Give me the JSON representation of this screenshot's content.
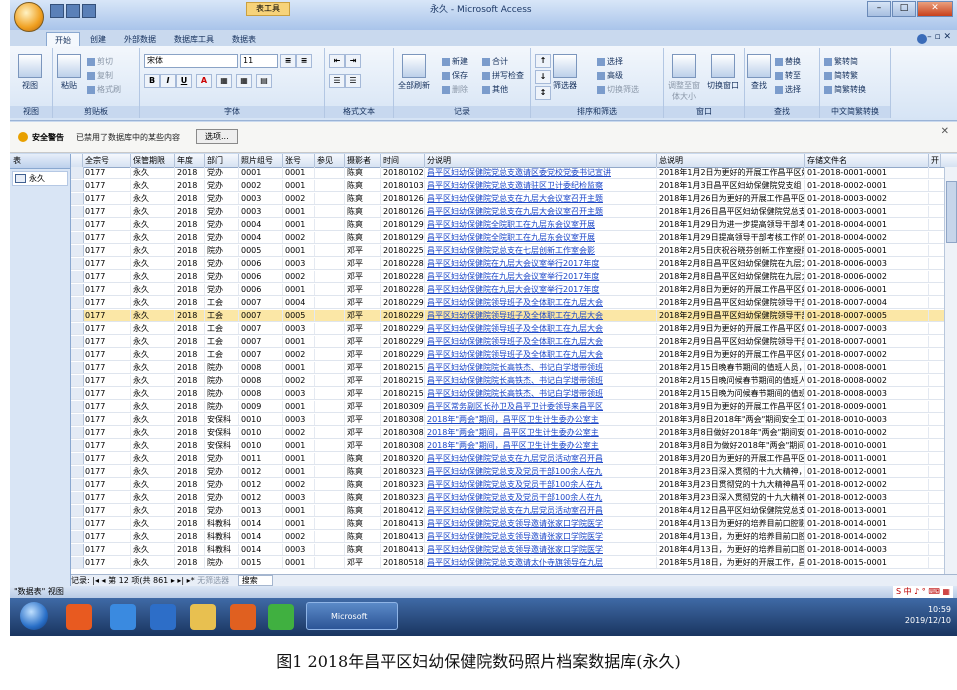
{
  "window": {
    "title": "永久 - Microsoft Access",
    "context_tab": "表工具"
  },
  "ribbon": {
    "tabs": [
      "开始",
      "创建",
      "外部数据",
      "数据库工具",
      "数据表"
    ],
    "clipboard": {
      "paste": "粘贴",
      "cut": "剪切",
      "copy": "复制",
      "format_painter": "格式刷",
      "label": "剪贴板"
    },
    "views": {
      "view": "视图",
      "label": "视图"
    },
    "font": {
      "name": "宋体",
      "size": "11",
      "label": "字体"
    },
    "richtext": {
      "label": "格式文本"
    },
    "records": {
      "refresh": "全部刷新",
      "new": "新建",
      "save": "保存",
      "delete": "删除",
      "totals": "合计",
      "spelling": "拼写检查",
      "more": "其他",
      "label": "记录"
    },
    "sortfilter": {
      "filter": "筛选器",
      "selection": "选择",
      "advanced": "高级",
      "toggle": "切换筛选",
      "label": "排序和筛选"
    },
    "window": {
      "fit": "调整至窗体大小",
      "switch": "切换窗口",
      "label": "窗口"
    },
    "find": {
      "find": "查找",
      "replace": "替换",
      "goto": "转至",
      "select": "选择",
      "label": "查找"
    },
    "chinese": {
      "t2s": "繁转简",
      "s2t": "简转繁",
      "convert": "简繁转换",
      "label": "中文简繁转换"
    }
  },
  "security": {
    "title": "安全警告",
    "message": "已禁用了数据库中的某些内容",
    "button": "选项..."
  },
  "nav": {
    "header": "表",
    "item": "永久"
  },
  "columns": [
    "全宗号",
    "保管期限",
    "年度",
    "部门",
    "照片组号",
    "张号",
    "参见",
    "摄影者",
    "时间",
    "分说明",
    "总说明",
    "存储文件名",
    "开"
  ],
  "rows": [
    [
      "0177",
      "永久",
      "2018",
      "党办",
      "0001",
      "0001",
      "",
      "陈爽",
      "20180102",
      "昌平区妇幼保健院党总支邀请区委党校党委书记宣讲",
      "2018年1月2日为更好的开展工作昌平区妇",
      "01-2018-0001-0001"
    ],
    [
      "0177",
      "永久",
      "2018",
      "党办",
      "0002",
      "0001",
      "",
      "陈爽",
      "20180103",
      "昌平区妇幼保健院党总支邀请驻区卫计委纪检监察",
      "2018年1月3日昌平区妇幼保健院党支组",
      "01-2018-0002-0001"
    ],
    [
      "0177",
      "永久",
      "2018",
      "党办",
      "0003",
      "0002",
      "",
      "陈爽",
      "20180126",
      "昌平区妇幼保健院党总支在九层大会议室召开主题",
      "2018年1月26日为更好的开展工作昌平区妇",
      "01-2018-0003-0002"
    ],
    [
      "0177",
      "永久",
      "2018",
      "党办",
      "0003",
      "0001",
      "",
      "陈爽",
      "20180126",
      "昌平区妇幼保健院党总支在九层大会议室召开主题",
      "2018年1月26日昌平区妇幼保健院党总支",
      "01-2018-0003-0001"
    ],
    [
      "0177",
      "永久",
      "2018",
      "党办",
      "0004",
      "0001",
      "",
      "陈爽",
      "20180129",
      "昌平区妇幼保健院全院职工在九层东会议室开展",
      "2018年1月29日为进一步提高领导干部考核",
      "01-2018-0004-0001"
    ],
    [
      "0177",
      "永久",
      "2018",
      "党办",
      "0004",
      "0002",
      "",
      "陈爽",
      "20180129",
      "昌平区妇幼保健院全院职工在九层东会议室开展",
      "2018年1月29日提高领导干部考核工作的科",
      "01-2018-0004-0002"
    ],
    [
      "0177",
      "永久",
      "2018",
      "院办",
      "0005",
      "0001",
      "",
      "邓平",
      "20180225",
      "昌平区妇幼保健院党总支在七层创新工作室会影",
      "2018年2月5日庆祝谷晓芬创新工作室授牌",
      "01-2018-0005-0001"
    ],
    [
      "0177",
      "永久",
      "2018",
      "党办",
      "0006",
      "0003",
      "",
      "邓平",
      "20180228",
      "昌平区妇幼保健院在九层大会议室举行2017年度",
      "2018年2月8日昌平区妇幼保健院在九层大",
      "01-2018-0006-0003"
    ],
    [
      "0177",
      "永久",
      "2018",
      "党办",
      "0006",
      "0002",
      "",
      "邓平",
      "20180228",
      "昌平区妇幼保健院在九层大会议室举行2017年度",
      "2018年2月8日昌平区妇幼保健院在九层大",
      "01-2018-0006-0002"
    ],
    [
      "0177",
      "永久",
      "2018",
      "党办",
      "0006",
      "0001",
      "",
      "邓平",
      "20180228",
      "昌平区妇幼保健院在九层大会议室举行2017年度",
      "2018年2月8日为更好的开展工作昌平区妇",
      "01-2018-0006-0001"
    ],
    [
      "0177",
      "永久",
      "2018",
      "工会",
      "0007",
      "0004",
      "",
      "邓平",
      "20180229",
      "昌平区妇幼保健院领导班子及全体职工在九层大会",
      "2018年2月9日昌平区妇幼保健院领导干部",
      "01-2018-0007-0004"
    ],
    [
      "0177",
      "永久",
      "2018",
      "工会",
      "0007",
      "0005",
      "",
      "邓平",
      "20180229",
      "昌平区妇幼保健院领导班子及全体职工在九层大会",
      "2018年2月9日昌平区妇幼保健院领导干部",
      "01-2018-0007-0005"
    ],
    [
      "0177",
      "永久",
      "2018",
      "工会",
      "0007",
      "0003",
      "",
      "邓平",
      "20180229",
      "昌平区妇幼保健院领导班子及全体职工在九层大会",
      "2018年2月9日为更好的开展工作昌平区妇",
      "01-2018-0007-0003"
    ],
    [
      "0177",
      "永久",
      "2018",
      "工会",
      "0007",
      "0001",
      "",
      "邓平",
      "20180229",
      "昌平区妇幼保健院领导班子及全体职工在九层大会",
      "2018年2月9日昌平区妇幼保健院领导干部",
      "01-2018-0007-0001"
    ],
    [
      "0177",
      "永久",
      "2018",
      "工会",
      "0007",
      "0002",
      "",
      "邓平",
      "20180229",
      "昌平区妇幼保健院领导班子及全体职工在九层大会",
      "2018年2月9日为更好的开展工作昌平区妇",
      "01-2018-0007-0002"
    ],
    [
      "0177",
      "永久",
      "2018",
      "院办",
      "0008",
      "0001",
      "",
      "邓平",
      "20180215",
      "昌平区妇幼保健院院长高铁杰、书记白学增带领班",
      "2018年2月15日晚春节期间的值班人员，于",
      "01-2018-0008-0001"
    ],
    [
      "0177",
      "永久",
      "2018",
      "院办",
      "0008",
      "0002",
      "",
      "邓平",
      "20180215",
      "昌平区妇幼保健院院长高铁杰、书记白学增带领班",
      "2018年2月15日晚问候春节期间的值班人员",
      "01-2018-0008-0002"
    ],
    [
      "0177",
      "永久",
      "2018",
      "院办",
      "0008",
      "0003",
      "",
      "邓平",
      "20180215",
      "昌平区妇幼保健院院长高铁杰、书记白学增带领班",
      "2018年2月15日晚为问候春节期间的值班人",
      "01-2018-0008-0003"
    ],
    [
      "0177",
      "永久",
      "2018",
      "院办",
      "0009",
      "0001",
      "",
      "邓平",
      "20180309",
      "昌平区常务副区长孙卫及昌平卫计委领导来昌平区",
      "2018年3月9日为更好的开展工作昌平区常",
      "01-2018-0009-0001"
    ],
    [
      "0177",
      "永久",
      "2018",
      "安保科",
      "0010",
      "0003",
      "",
      "邓平",
      "20180308",
      "2018年\"两会\"期间，昌平区卫生计生委办公室主",
      "2018年3月8日2018年\"两会\"期间安全工",
      "01-2018-0010-0003"
    ],
    [
      "0177",
      "永久",
      "2018",
      "安保科",
      "0010",
      "0002",
      "",
      "邓平",
      "20180308",
      "2018年\"两会\"期间，昌平区卫生计生委办公室主",
      "2018年3月8日做好2018年\"两会\"期间安",
      "01-2018-0010-0002"
    ],
    [
      "0177",
      "永久",
      "2018",
      "安保科",
      "0010",
      "0001",
      "",
      "邓平",
      "20180308",
      "2018年\"两会\"期间，昌平区卫生计生委办公室主",
      "2018年3月8日为做好2018年\"两会\"期间",
      "01-2018-0010-0001"
    ],
    [
      "0177",
      "永久",
      "2018",
      "党办",
      "0011",
      "0001",
      "",
      "陈爽",
      "20180320",
      "昌平区妇幼保健院党总支在九层党员活动室召开昌",
      "2018年3月20日为更好的开展工作昌平区妇",
      "01-2018-0011-0001"
    ],
    [
      "0177",
      "永久",
      "2018",
      "党办",
      "0012",
      "0001",
      "",
      "陈爽",
      "20180323",
      "昌平区妇幼保健院党总支及党员干部100余人在九",
      "2018年3月23日深入贯彻的十九大精神，",
      "01-2018-0012-0001"
    ],
    [
      "0177",
      "永久",
      "2018",
      "党办",
      "0012",
      "0002",
      "",
      "陈爽",
      "20180323",
      "昌平区妇幼保健院党总支及党员干部100余人在九",
      "2018年3月23日贯彻党的十九大精神昌平区",
      "01-2018-0012-0002"
    ],
    [
      "0177",
      "永久",
      "2018",
      "党办",
      "0012",
      "0003",
      "",
      "陈爽",
      "20180323",
      "昌平区妇幼保健院党总支及党员干部100余人在九",
      "2018年3月23日深入贯彻党的十九大精神",
      "01-2018-0012-0003"
    ],
    [
      "0177",
      "永久",
      "2018",
      "党办",
      "0013",
      "0001",
      "",
      "陈爽",
      "20180412",
      "昌平区妇幼保健院党总支在九层党员活动室召开昌",
      "2018年4月12日昌平区妇幼保健院党总支在",
      "01-2018-0013-0001"
    ],
    [
      "0177",
      "永久",
      "2018",
      "科教科",
      "0014",
      "0001",
      "",
      "陈爽",
      "20180413",
      "昌平区妇幼保健院党总支领导邀请张家口学院医学",
      "2018年4月13日为更好的培养目前口腔影响",
      "01-2018-0014-0001"
    ],
    [
      "0177",
      "永久",
      "2018",
      "科教科",
      "0014",
      "0002",
      "",
      "陈爽",
      "20180413",
      "昌平区妇幼保健院党总支领导邀请张家口学院医学",
      "2018年4月13日，为更好的培养目前口腔、",
      "01-2018-0014-0002"
    ],
    [
      "0177",
      "永久",
      "2018",
      "科教科",
      "0014",
      "0003",
      "",
      "陈爽",
      "20180413",
      "昌平区妇幼保健院党总支领导邀请张家口学院医学",
      "2018年4月13日，为更好的培养目前口腔、",
      "01-2018-0014-0003"
    ],
    [
      "0177",
      "永久",
      "2018",
      "院办",
      "0015",
      "0001",
      "",
      "邓平",
      "20180518",
      "昌平区妇幼保健院党总支邀请太仆寺旗领导在九层",
      "2018年5月18日，为更好的开展工作，昌平",
      "01-2018-0015-0001"
    ]
  ],
  "record_nav": {
    "prefix": "记录:",
    "position": "第 12 项(共 861",
    "filter": "无筛选器",
    "search": "搜索"
  },
  "status": {
    "left": "\"数据表\" 视图"
  },
  "taskbar": {
    "task": "Microsoft Acces...",
    "time": "10:59",
    "date": "2019/12/10"
  },
  "caption": "图1   2018年昌平区妇幼保健院数码照片档案数据库(永久)",
  "colors": {
    "selected_row": "#fbe7a6",
    "link": "#1a45c8",
    "ribbon": "#d6e4f5"
  }
}
